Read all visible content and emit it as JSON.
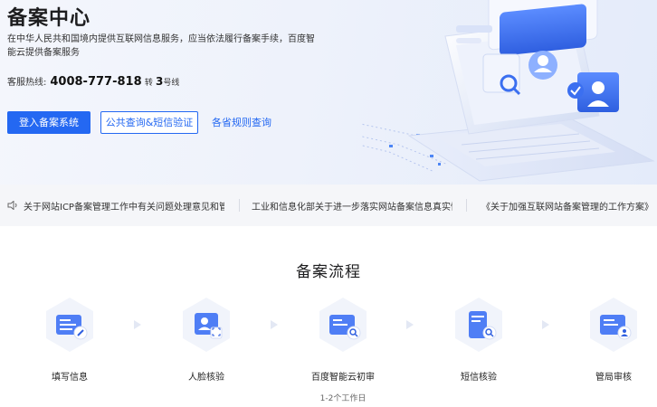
{
  "hero": {
    "title": "备案中心",
    "description": "在中华人民共和国境内提供互联网信息服务，应当依法履行备案手续，百度智能云提供备案服务",
    "hotline_label": "客服热线:",
    "hotline_number": "4008-777-818",
    "hotline_ext_prefix": "转",
    "hotline_ext": "3",
    "hotline_ext_suffix": "号线",
    "buttons": {
      "login": "登入备案系统",
      "query": "公共查询&短信验证",
      "rules": "各省规则查询"
    }
  },
  "news": {
    "items": [
      "关于网站ICP备案管理工作中有关问题处理意见和管理…",
      "工业和信息化部关于进一步落实网站备案信息真实性核…",
      "《关于加强互联网站备案管理的工作方案》"
    ]
  },
  "flow": {
    "title": "备案流程",
    "steps": [
      {
        "label": "填写信息",
        "sub": "",
        "icon": "form-edit-icon"
      },
      {
        "label": "人脸核验",
        "sub": "",
        "icon": "face-verify-icon"
      },
      {
        "label": "百度智能云初审",
        "sub": "1-2个工作日",
        "icon": "review-search-icon"
      },
      {
        "label": "短信核验",
        "sub": "",
        "icon": "sms-verify-icon"
      },
      {
        "label": "管局审核",
        "sub": "",
        "icon": "authority-review-icon"
      }
    ]
  },
  "colors": {
    "primary": "#2468f2",
    "hero_bg": "#eef2fb",
    "news_bg": "#f5f6f9"
  }
}
